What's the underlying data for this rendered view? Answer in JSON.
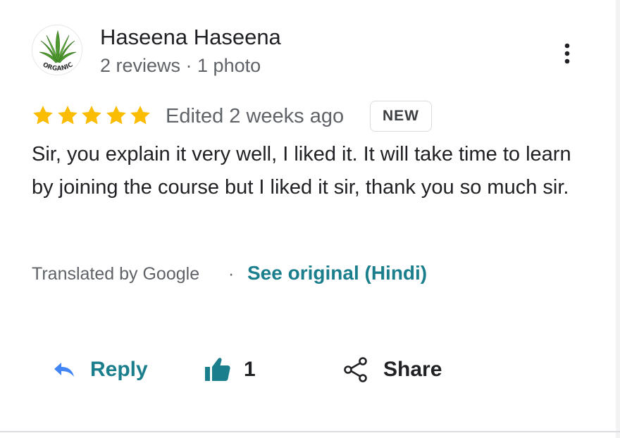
{
  "review": {
    "author": {
      "name": "Haseena Haseena",
      "meta": "2 reviews · 1 photo",
      "avatar_text": "ORGANIC"
    },
    "rating": 5,
    "rating_max": 5,
    "edited": "Edited 2 weeks ago",
    "badge": "NEW",
    "text": "Sir, you explain it very well, I liked it. It will take time to learn by joining the course but I liked it sir, thank you so much sir.",
    "translation": {
      "translated_by": "Translated by Google",
      "separator": "·",
      "see_original": "See original (Hindi)"
    },
    "actions": {
      "reply_label": "Reply",
      "like_count": "1",
      "share_label": "Share"
    }
  },
  "icons": {
    "more": "more-vert-icon",
    "star": "star-icon",
    "reply": "reply-icon",
    "like": "thumb-up-icon",
    "share": "share-icon"
  },
  "colors": {
    "star": "#fbbc04",
    "accent": "#1a7e8c",
    "reply_icon": "#4285f4",
    "text_primary": "#202124",
    "text_secondary": "#5f6368",
    "divider": "#dadce0"
  }
}
